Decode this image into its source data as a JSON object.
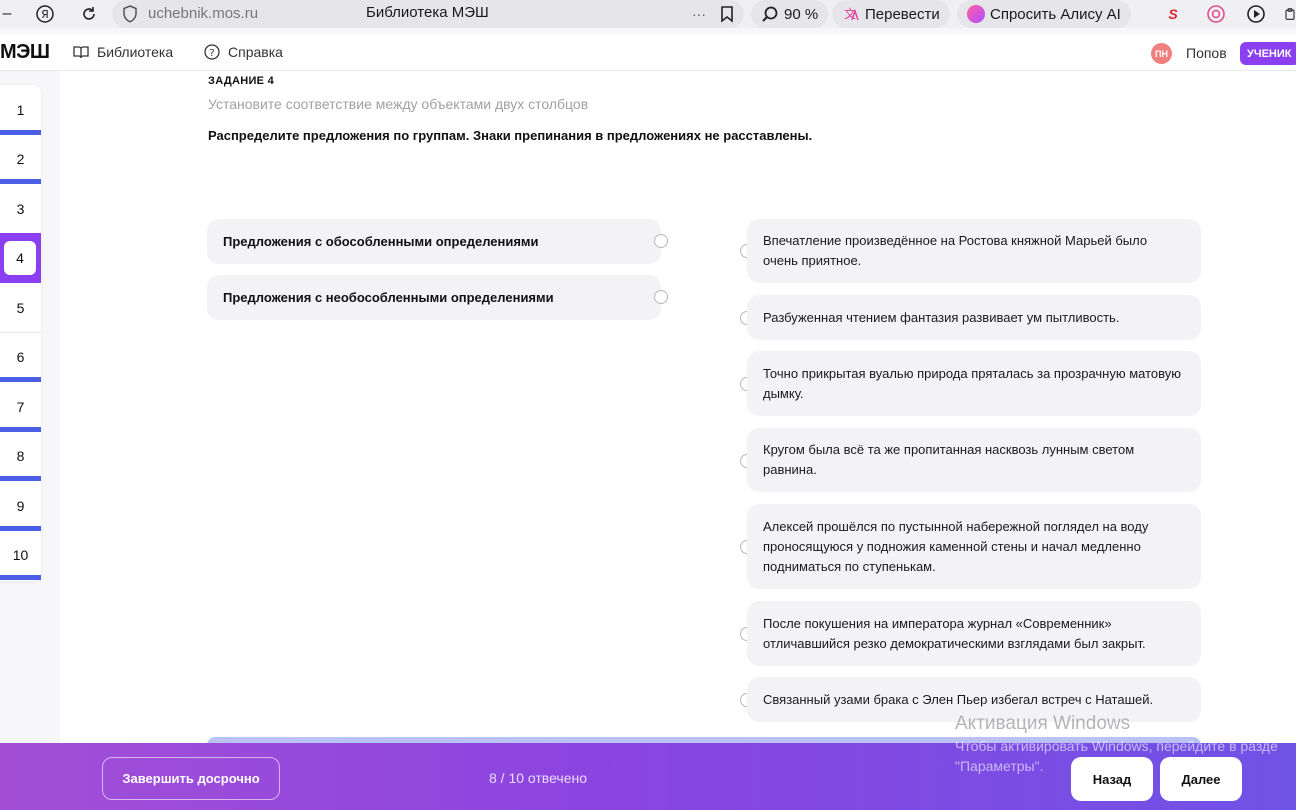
{
  "browser": {
    "url": "uchebnik.mos.ru",
    "title": "Библиотека МЭШ",
    "zoom": "90 %",
    "translate_label": "Перевести",
    "alice_label": "Спросить Алису AI",
    "more_glyph": "···"
  },
  "header": {
    "logo": "МЭШ",
    "nav": [
      {
        "label": "Библиотека",
        "icon": "book-icon"
      },
      {
        "label": "Справка",
        "icon": "help-icon"
      }
    ],
    "user": {
      "initials": "ПН",
      "name": "Попов",
      "role": "УЧЕНИК"
    }
  },
  "question_nav": {
    "items": [
      "1",
      "2",
      "3",
      "4",
      "5",
      "6",
      "7",
      "8",
      "9",
      "10"
    ],
    "active": "4",
    "answered": [
      "1",
      "2",
      "6",
      "7",
      "8",
      "9",
      "10"
    ]
  },
  "task": {
    "label": "ЗАДАНИЕ 4",
    "subtitle": "Установите соответствие между объектами двух столбцов",
    "instruction": "Распределите предложения по группам. Знаки препинания в предложениях не расставлены.",
    "groups": [
      "Предложения с обособленными определениями",
      "Предложения с необособленными определениями"
    ],
    "sentences": [
      "Впечатление произведённое на Ростова княжной Марьей было очень приятное.",
      "Разбуженная чтением фантазия развивает ум пытливость.",
      "Точно прикрытая вуалью природа пряталась за прозрачную матовую дымку.",
      "Кругом была всё та же пропитанная насквозь лунным светом равнина.",
      "Алексей прошёлся по пустынной набережной поглядел на воду проносящуюся у подножия каменной стены и начал медленно подниматься по ступенькам.",
      "После покушения на императора журнал «Современник» отличавшийся резко демократическими взглядами был закрыт.",
      "Связанный узами брака с Элен Пьер избегал встреч с Наташей."
    ]
  },
  "footer": {
    "finish_label": "Завершить досрочно",
    "progress": "8 / 10 отвечено",
    "back_label": "Назад",
    "next_label": "Далее"
  },
  "watermark": {
    "title": "Активация Windows",
    "line1": "Чтобы активировать Windows, перейдите в разде",
    "line2": "\"Параметры\"."
  },
  "colors": {
    "accent": "#8a3ff0",
    "answered_bar": "#4a5ee8",
    "card_bg": "#f3f3f6"
  }
}
